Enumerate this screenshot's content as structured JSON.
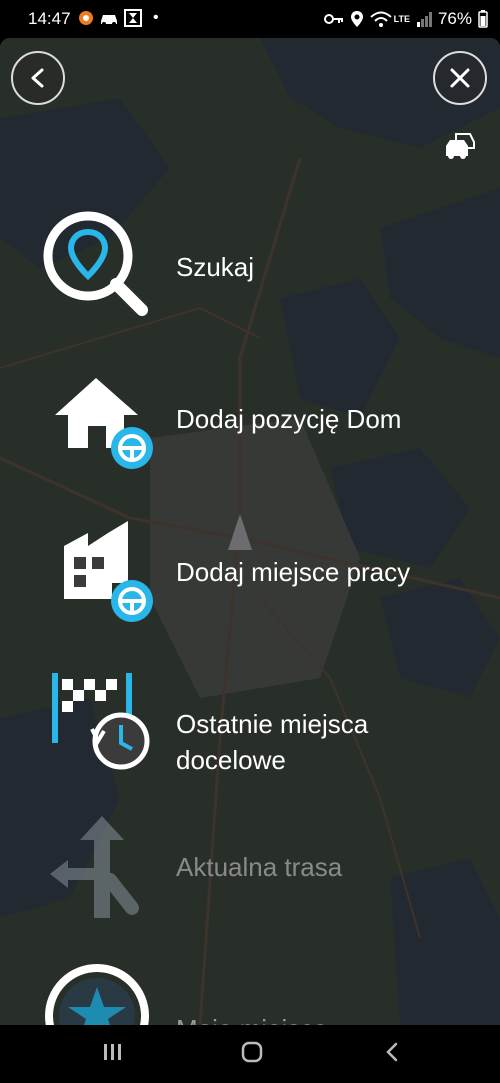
{
  "status_bar": {
    "time": "14:47",
    "battery": "76%",
    "network": "LTE",
    "icons_left": [
      "notification-app-icon",
      "car-icon",
      "hourglass-icon",
      "dot-icon"
    ],
    "icons_right": [
      "key-icon",
      "location-icon",
      "wifi-icon",
      "signal-icon",
      "battery-icon"
    ]
  },
  "header": {
    "back_icon": "chevron-left-icon",
    "close_icon": "close-icon",
    "traffic_icon": "traffic-cars-icon"
  },
  "menu": {
    "items": [
      {
        "label": "Szukaj",
        "icon": "search-pin-icon",
        "enabled": true
      },
      {
        "label": "Dodaj pozycję Dom",
        "icon": "home-add-icon",
        "enabled": true
      },
      {
        "label": "Dodaj miejsce pracy",
        "icon": "work-add-icon",
        "enabled": true
      },
      {
        "label": "Ostatnie miejsca\ndocelowe",
        "icon": "recent-destinations-icon",
        "enabled": true
      },
      {
        "label": "Aktualna trasa",
        "icon": "current-route-icon",
        "enabled": false
      },
      {
        "label": "Moje miejsca",
        "icon": "my-places-star-icon",
        "enabled": true
      }
    ]
  },
  "colors": {
    "accent": "#29b6e8",
    "overlay": "#1e1e1e",
    "map_land": "#3a4a3c",
    "map_water": "#2c3a4a"
  },
  "nav_bar": {
    "recents_icon": "recents-icon",
    "home_icon": "home-icon",
    "back_icon": "back-icon"
  }
}
